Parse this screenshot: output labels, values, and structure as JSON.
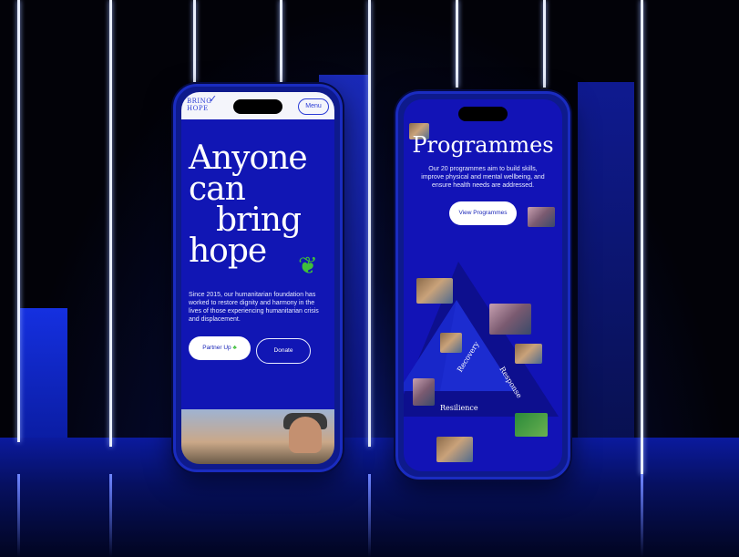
{
  "phone_left": {
    "logo": {
      "line1": "BRING",
      "line2": "HOPE"
    },
    "menu_label": "Menu",
    "hero_lines": [
      "Anyone",
      "can",
      "bring",
      "hope"
    ],
    "description": "Since 2015, our humanitarian foundation has worked to restore dignity and harmony in the lives of those experiencing humanitarian crisis and displacement.",
    "partner_label": "Partner Up",
    "donate_label": "Donate",
    "leaf_icon": "sprout-icon"
  },
  "phone_right": {
    "title": "Programmes",
    "description": "Our 20 programmes aim to build skills, improve physical and mental wellbeing, and ensure health needs are addressed.",
    "view_label": "View Programmes",
    "cycle_labels": {
      "left": "Recovery",
      "right": "Response",
      "bottom": "Resilience"
    }
  },
  "colors": {
    "primary_blue": "#1116b4",
    "accent_blue": "#2b3cd6",
    "leaf_green": "#3fbf3a",
    "white": "#ffffff"
  }
}
